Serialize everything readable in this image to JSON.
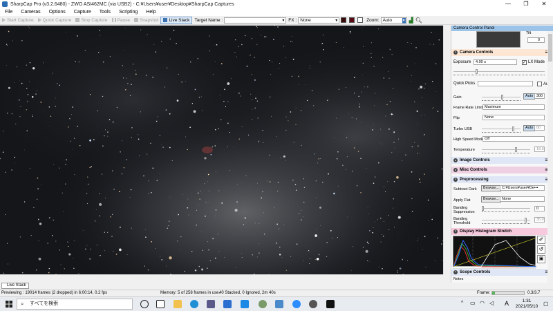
{
  "window": {
    "title": "SharpCap Pro (v3.2.6480) - ZWO ASI462MC (via USB2) - C:¥Users¥user¥Desktop¥SharpCap Captures",
    "controls": [
      "—",
      "❐",
      "✕"
    ]
  },
  "menu": [
    "File",
    "Cameras",
    "Options",
    "Capture",
    "Tools",
    "Scripting",
    "Help"
  ],
  "toolbar": {
    "start_capture": "Start Capture",
    "quick_capture": "Quick Capture",
    "stop_capture": "Stop Capture",
    "pause": "Pause",
    "snapshot": "Snapshot",
    "live_stack": "Live Stack",
    "target_name_label": "Target Name :",
    "target_name_value": "",
    "fx_label": "FX :",
    "fx_value": "None",
    "zoom_label": "Zoom:",
    "zoom_value": "Auto"
  },
  "panel": {
    "header": "Camera Control Panel",
    "tilt_label": "Tilt",
    "tilt_value": "0",
    "camera_controls": {
      "title": "Camera Controls",
      "exposure_label": "Exposure",
      "exposure_value": "4.00 s",
      "lx_mode_label": "LX Mode",
      "lx_mode_checked": true,
      "quick_picks_label": "Quick Picks",
      "auto_label": "Auto",
      "gain_label": "Gain",
      "gain_auto": "Auto",
      "gain_value": "300",
      "frame_rate_label": "Frame Rate Limit",
      "frame_rate_value": "Maximum",
      "flip_label": "Flip",
      "flip_value": "None",
      "turbo_usb_label": "Turbo USB",
      "turbo_auto": "Auto",
      "turbo_value": "80",
      "high_speed_label": "High Speed Mode",
      "high_speed_value": "Off",
      "temperature_label": "Temperature",
      "temperature_value": "18.9"
    },
    "image_controls": "Image Controls",
    "misc_controls": "Misc Controls",
    "preprocessing": {
      "title": "Preprocessing",
      "subtract_dark_label": "Subtract Dark",
      "browse_label": "Browse...",
      "subtract_dark_value": "C:¥Users¥user¥De•••",
      "apply_flat_label": "Apply Flat",
      "apply_flat_value": "None",
      "banding_suppression_label": "Banding Suppression",
      "banding_suppression_value": "0",
      "banding_threshold_label": "Banding Threshold",
      "banding_threshold_value": "35.0"
    },
    "histogram": "Display Histogram Stretch",
    "scope_controls": "Scope Controls",
    "notes": "Notes"
  },
  "bottom_tab": "Live Stack",
  "status": {
    "previewing": "Previewing : 19014 frames (2 dropped) in 6:00:14, 0.2 fps",
    "memory": "Memory: 5 of 258 frames in use.",
    "stacked": "40 Stacked, 0 Ignored, 2m 40s",
    "frame_label": "Frame:",
    "frame_value": "0.3/3.7",
    "frame_progress": 0.08
  },
  "taskbar": {
    "search_placeholder": "すべてを検索",
    "time": "1:31",
    "date": "2021/05/10",
    "ime": "A"
  },
  "colors": {
    "sky": "#14161a",
    "camera_header": "#fde7d4",
    "misc_header": "#efd0e2",
    "histogram_header": "#f6c9dc"
  }
}
